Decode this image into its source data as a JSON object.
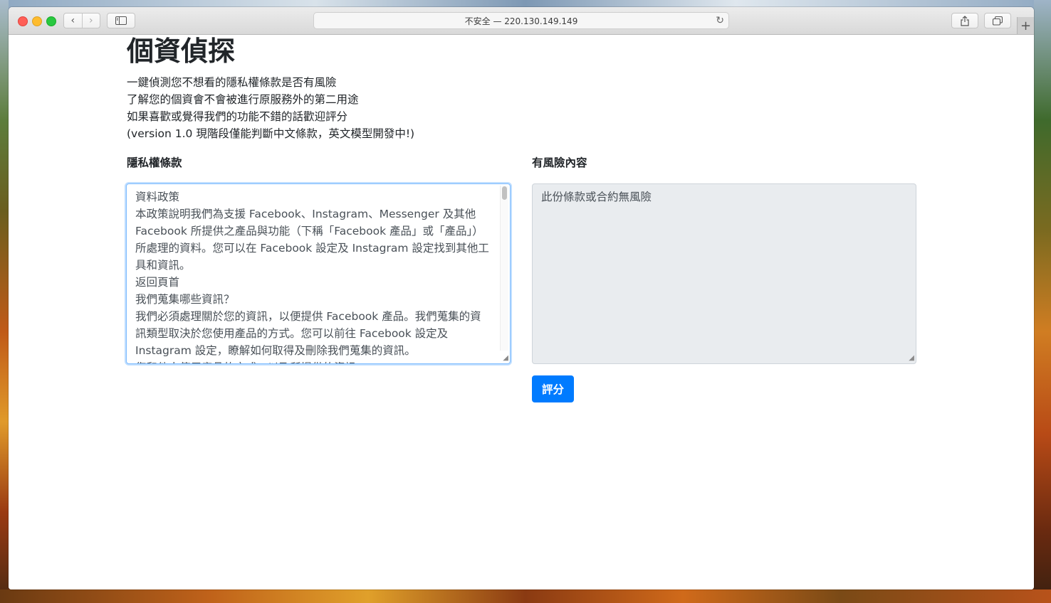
{
  "browser": {
    "address": "不安全 — 220.130.149.149",
    "back_icon": "‹",
    "forward_icon": "›",
    "reload_icon": "↻",
    "newtab_icon": "+"
  },
  "page": {
    "title": "個資偵探",
    "intro": [
      "一鍵偵測您不想看的隱私權條款是否有風險",
      "了解您的個資會不會被進行原服務外的第二用途",
      "如果喜歡或覺得我們的功能不錯的話歡迎評分",
      "(version 1.0 現階段僅能判斷中文條款，英文模型開發中!)"
    ],
    "left_label": "隱私權條款",
    "right_label": "有風險內容",
    "input_text": "資料政策\n本政策說明我們為支援 Facebook、Instagram、Messenger 及其他 Facebook 所提供之產品與功能（下稱「Facebook 產品」或「產品」）所處理的資料。您可以在 Facebook 設定及 Instagram 設定找到其他工具和資訊。\n返回頁首\n我們蒐集哪些資訊？\n我們必須處理關於您的資訊，以便提供 Facebook 產品。我們蒐集的資訊類型取決於您使用產品的方式。您可以前往 Facebook 設定及 Instagram 設定，瞭解如何取得及刪除我們蒐集的資訊。\n您和他人使用產品的方式，以及所提供的資訊",
    "output_text": "此份條款或合約無風險",
    "score_button": "評分"
  },
  "colors": {
    "accent": "#007bff",
    "readonly_bg": "#e9ecef",
    "text": "#212529"
  }
}
